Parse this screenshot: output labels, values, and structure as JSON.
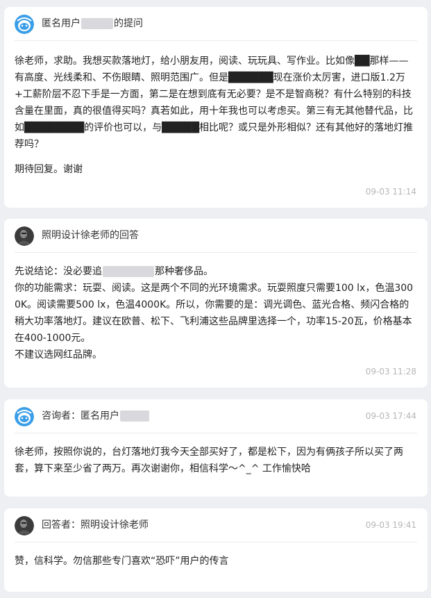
{
  "q1": {
    "header_pre": "匿名用户",
    "header_post": "的提问",
    "body": "徐老师，求助。我想买款落地灯，给小朋友用，阅读、玩玩具、写作业。比如像██那样——有高度、光线柔和、不伤眼睛、照明范围广。但是██████现在涨价太厉害，进口版1.2万+工薪阶层不忍下手是一方面，第二是在想到底有无必要？是不是智商税？有什么特别的科技含量在里面，真的很值得买吗？真若如此，用十年我也可以考虑买。第三有无其他替代品，比如████████的评价也可以，与█████相比呢？或只是外形相似？还有其他好的落地灯推荐吗？",
    "closing": "期待回复。谢谢",
    "time": "09-03 11:14"
  },
  "a1": {
    "header": "照明设计徐老师的回答",
    "line1_pre": "先说结论：没必要追",
    "line1_post": "那种奢侈品。",
    "para": "你的功能需求：玩耍、阅读。这是两个不同的光环境需求。玩耍照度只需要100 lx，色温3000K。阅读需要500 lx，色温4000K。所以，你需要的是：调光调色、蓝光合格、频闪合格的稍大功率落地灯。建议在欧普、松下、飞利浦这些品牌里选择一个，功率15-20瓦，价格基本在400-1000元。",
    "last": "不建议选网红品牌。",
    "time": "09-03 11:28"
  },
  "q2": {
    "header_pre": "咨询者：匿名用户",
    "time": "09-03 17:44",
    "body": "徐老师，按照你说的，台灯落地灯我今天全部买好了，都是松下，因为有俩孩子所以买了两套，算下来至少省了两万。再次谢谢你，相信科学～^_^ 工作愉快哈"
  },
  "a2": {
    "header": "回答者：照明设计徐老师",
    "time": "09-03 19:41",
    "body": "赞，信科学。勿信那些专门喜欢“恐吓”用户的传言"
  }
}
